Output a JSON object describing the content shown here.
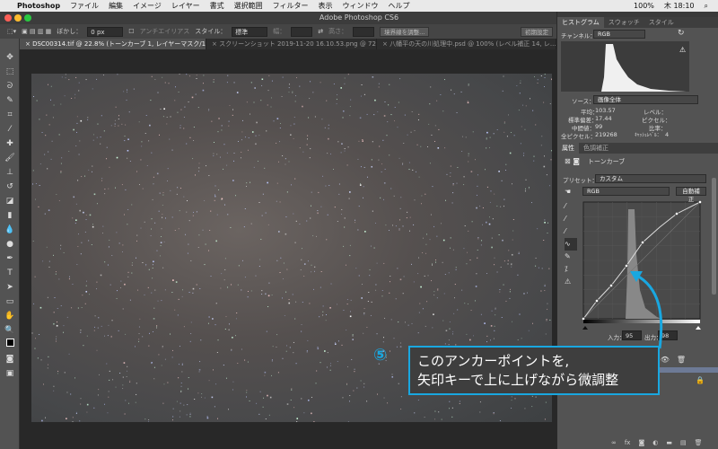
{
  "menubar": {
    "apple": "",
    "app": "Photoshop",
    "items": [
      "ファイル",
      "編集",
      "イメージ",
      "レイヤー",
      "書式",
      "選択範囲",
      "フィルター",
      "表示",
      "ウィンドウ",
      "ヘルプ"
    ],
    "battery": "100%",
    "clock": "木 18:10"
  },
  "window": {
    "title": "Adobe Photoshop CS6"
  },
  "options": {
    "feather_label": "ぼかし：",
    "feather_value": "0 px",
    "antialias": "アンチエイリアス",
    "style_label": "スタイル：",
    "style_value": "標準",
    "width_label": "幅：",
    "height_label": "高さ：",
    "refine_edge": "境界線を調整...",
    "workspace": "初期設定"
  },
  "tabs": [
    {
      "label": "× DSC00314.tif @ 22.8% (トーンカーブ 1, レイヤーマスク/16) *"
    },
    {
      "label": "× スクリーンショット 2019-11-20 16.10.53.png @ 72..."
    },
    {
      "label": "× 八幡平の天の川処理中.psd @ 100% (レベル補正 14, レ..."
    }
  ],
  "histogram": {
    "tabs": [
      "ヒストグラム",
      "スウォッチ",
      "スタイル"
    ],
    "channel_label": "チャンネル：",
    "channel_value": "RGB",
    "source_label": "ソース：",
    "source_value": "画像全体",
    "mean_label": "平均：",
    "mean": "103.57",
    "std_label": "標準偏差：",
    "std": "17.44",
    "median_label": "中間値：",
    "median": "99",
    "pixels_label": "全ピクセル：",
    "pixels": "219268",
    "level_label": "レベル：",
    "count_label": "ピクセル：",
    "percent_label": "比率：",
    "cache_label": "ｷｬｯｼｭﾚﾍﾞﾙ：",
    "cache": "4"
  },
  "properties": {
    "tabs": [
      "属性",
      "色調補正"
    ],
    "title": "トーンカーブ",
    "preset_label": "プリセット：",
    "preset_value": "カスタム",
    "channel_value": "RGB",
    "auto_button": "自動補正",
    "input_label": "入力：",
    "input_value": "95",
    "output_label": "出力：",
    "output_value": "98"
  },
  "callout": {
    "number": "⑤",
    "line1": "このアンカーポイントを,",
    "line2": "矢印キーで上に上げながら微調整"
  },
  "colors": {
    "accent": "#19a7e0"
  }
}
